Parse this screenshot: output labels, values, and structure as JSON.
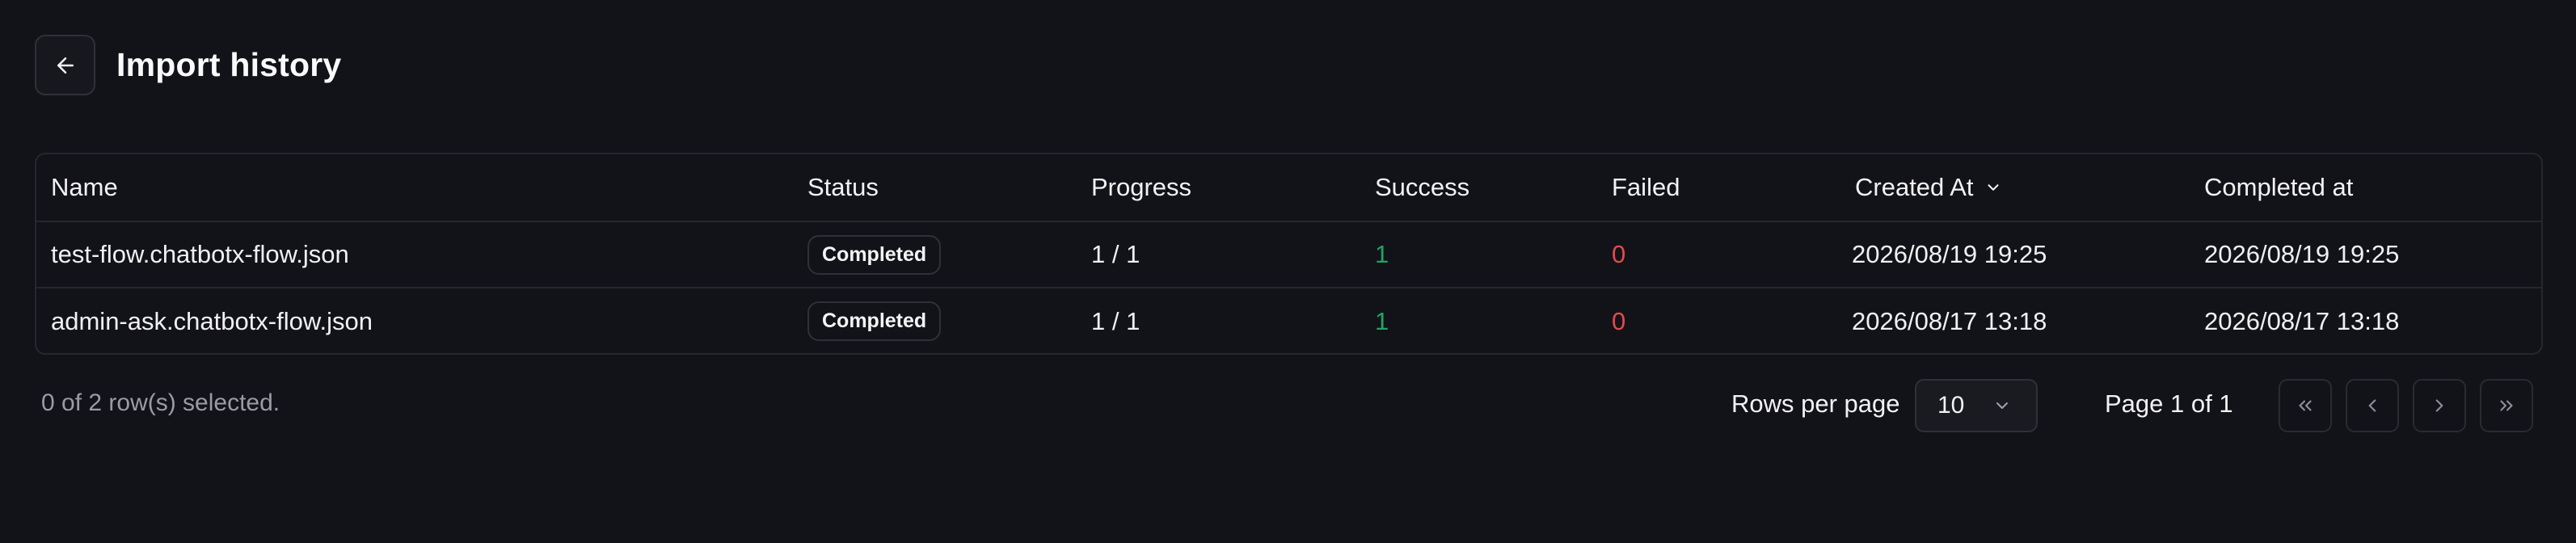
{
  "header": {
    "title": "Import history",
    "back_icon": "arrow-left-icon"
  },
  "table": {
    "columns": {
      "name": "Name",
      "status": "Status",
      "progress": "Progress",
      "success": "Success",
      "failed": "Failed",
      "created_at": "Created At",
      "completed_at": "Completed at"
    },
    "sort_icon": "chevron-down-icon",
    "rows": [
      {
        "name": "test-flow.chatbotx-flow.json",
        "status": "Completed",
        "progress": "1 / 1",
        "success": "1",
        "failed": "0",
        "created_at": "2026/08/19 19:25",
        "completed_at": "2026/08/19 19:25"
      },
      {
        "name": "admin-ask.chatbotx-flow.json",
        "status": "Completed",
        "progress": "1 / 1",
        "success": "1",
        "failed": "0",
        "created_at": "2026/08/17 13:18",
        "completed_at": "2026/08/17 13:18"
      }
    ]
  },
  "footer": {
    "selected_text": "0 of 2 row(s) selected.",
    "rows_per_page_label": "Rows per page",
    "rows_per_page_value": "10",
    "page_info": "Page 1 of 1",
    "pager_icons": [
      "chevrons-left-icon",
      "chevron-left-icon",
      "chevron-right-icon",
      "chevrons-right-icon"
    ]
  },
  "colors": {
    "background": "#121318",
    "border": "#26272e",
    "success": "#1fa463",
    "failed": "#e5484d",
    "muted_text": "#9a9ba6"
  }
}
